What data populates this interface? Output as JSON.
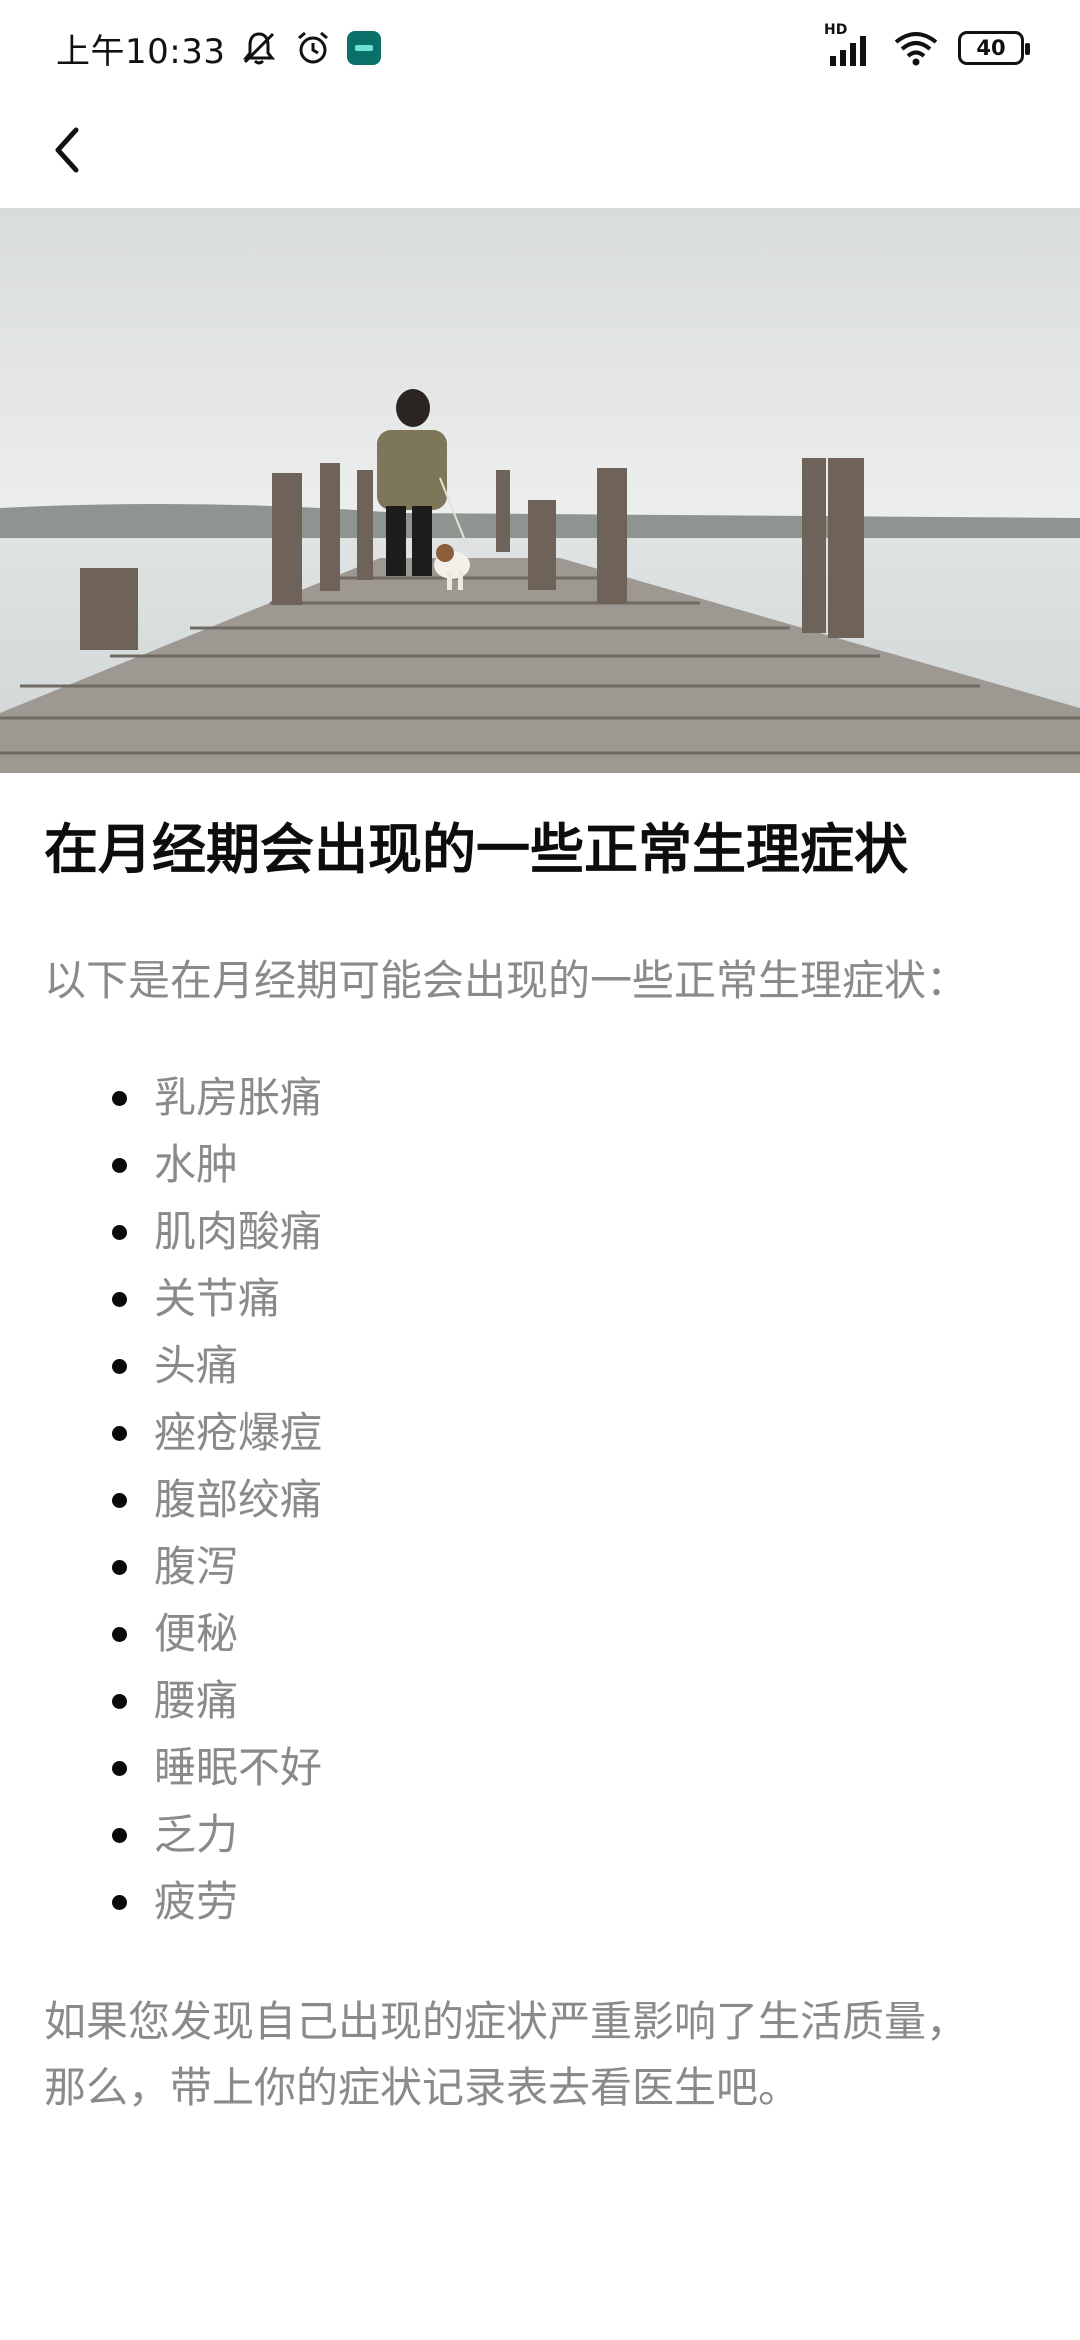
{
  "status_bar": {
    "time": "上午10:33",
    "network": "HD",
    "battery": "40",
    "icons": [
      "mute-bell-icon",
      "alarm-icon",
      "app-badge-icon",
      "signal-icon",
      "wifi-icon",
      "battery-icon"
    ]
  },
  "nav": {
    "back_icon": "chevron-left-icon"
  },
  "hero": {
    "description_icon": "pier-photo"
  },
  "article": {
    "title": "在月经期会出现的一些正常生理症状",
    "intro": "以下是在月经期可能会出现的一些正常生理症状：",
    "symptoms": [
      "乳房胀痛",
      "水肿",
      "肌肉酸痛",
      "关节痛",
      "头痛",
      "痤疮爆痘",
      "腹部绞痛",
      "腹泻",
      "便秘",
      "腰痛",
      "睡眠不好",
      "乏力",
      "疲劳"
    ],
    "outro_line1": "如果您发现自己出现的症状严重影响了生活质量，",
    "outro_line2": "那么，带上你的症状记录表去看医生吧。"
  },
  "colors": {
    "text_primary": "#0d0d0d",
    "text_secondary": "#8a8a8a",
    "app_badge": "#0b6f6a"
  }
}
